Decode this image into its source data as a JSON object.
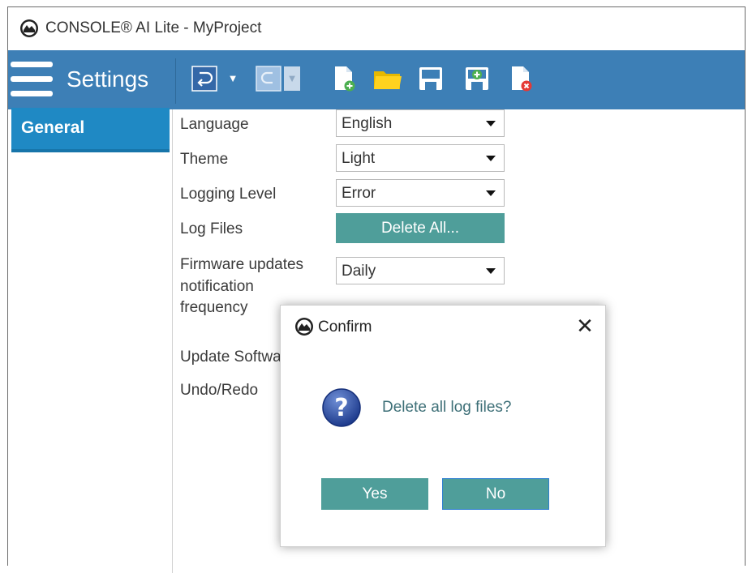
{
  "window": {
    "title": "CONSOLE® AI Lite - MyProject"
  },
  "toolbar": {
    "title": "Settings",
    "buttons": [
      {
        "icon": "undo-icon"
      },
      {
        "icon": "redo-icon"
      },
      {
        "icon": "new-file-icon"
      },
      {
        "icon": "open-folder-icon"
      },
      {
        "icon": "save-icon"
      },
      {
        "icon": "save-as-icon"
      },
      {
        "icon": "close-file-icon"
      }
    ],
    "colors": {
      "bar": "#3d7fb6",
      "accent": "#4f9e9a"
    }
  },
  "sidebar": {
    "items": [
      {
        "label": "General",
        "selected": true
      }
    ]
  },
  "settings": {
    "language": {
      "label": "Language",
      "value": "English"
    },
    "theme": {
      "label": "Theme",
      "value": "Light"
    },
    "logging_level": {
      "label": "Logging Level",
      "value": "Error"
    },
    "log_files": {
      "label": "Log Files",
      "button": "Delete All..."
    },
    "firmware": {
      "label_lines": [
        "Firmware updates",
        "notification",
        "frequency"
      ],
      "value": "Daily"
    },
    "update_software": {
      "label": "Update Softwa"
    },
    "undo_redo": {
      "label": "Undo/Redo"
    }
  },
  "dialog": {
    "title": "Confirm",
    "close": "✕",
    "icon": "question-icon",
    "message": "Delete all log files?",
    "yes": "Yes",
    "no": "No"
  }
}
